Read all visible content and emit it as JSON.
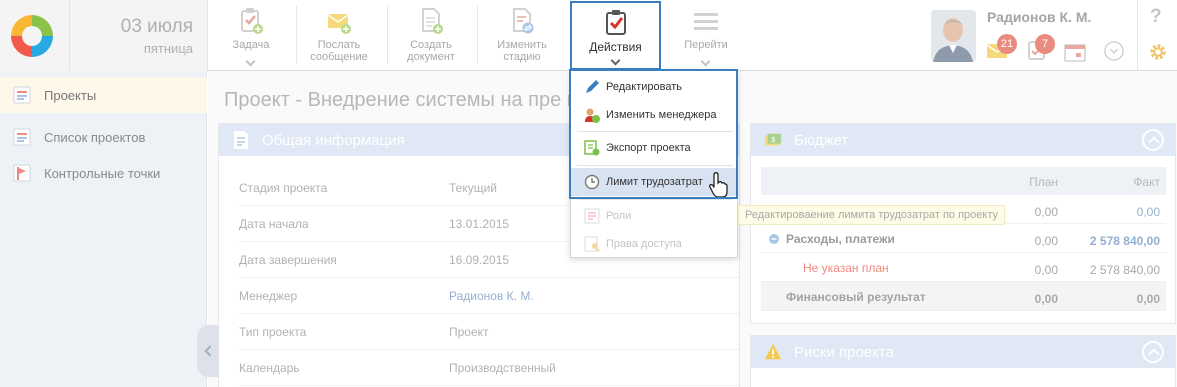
{
  "header": {
    "date_day": "03 июля",
    "date_weekday": "пятница",
    "toolbar": [
      {
        "label": "Задача",
        "icon": "task-clipboard-icon"
      },
      {
        "label": "Послать сообщение",
        "icon": "send-message-icon"
      },
      {
        "label": "Создать документ",
        "icon": "create-document-icon"
      },
      {
        "label": "Изменить стадию",
        "icon": "change-stage-icon"
      },
      {
        "label": "Действия",
        "icon": "actions-checklist-icon"
      },
      {
        "label": "Перейти",
        "icon": "navigate-menu-icon"
      }
    ],
    "user_name": "Радионов К. М.",
    "messages_count": "21",
    "tasks_count": "7",
    "help": "?"
  },
  "sidebar": {
    "items": [
      {
        "label": "Проекты",
        "icon": "projects-icon"
      },
      {
        "label": "Список проектов",
        "icon": "project-list-icon"
      },
      {
        "label": "Контрольные точки",
        "icon": "milestones-flag-icon"
      }
    ]
  },
  "main": {
    "page_title": "Проект - Внедрение системы на пре                  nWest\"",
    "general": {
      "title": "Общая информация",
      "rows": [
        {
          "label": "Стадия проекта",
          "value": "Текущий"
        },
        {
          "label": "Дата начала",
          "value": "13.01.2015"
        },
        {
          "label": "Дата завершения",
          "value": "16.09.2015"
        },
        {
          "label": "Менеджер",
          "value": "Радионов К. М."
        },
        {
          "label": "Тип проекта",
          "value": "Проект"
        },
        {
          "label": "Календарь",
          "value": "Производственный"
        }
      ]
    },
    "budget": {
      "title": "Бюджет",
      "col_plan": "План",
      "col_fact": "Факт",
      "rows": [
        {
          "name": "",
          "plan": "0,00",
          "fact": "0,00"
        },
        {
          "name": "Расходы, платежи",
          "plan": "0,00",
          "fact": "2 578 840,00"
        },
        {
          "name": "Не указан план",
          "plan": "0,00",
          "fact": "2 578 840,00"
        },
        {
          "name": "Финансовый результат",
          "plan": "0,00",
          "fact": "0,00"
        }
      ]
    },
    "risks": {
      "title": "Риски проекта"
    }
  },
  "actions_menu": {
    "items": [
      {
        "label": "Редактировать",
        "icon": "edit-pencil-icon",
        "enabled": true
      },
      {
        "label": "Изменить менеджера",
        "icon": "change-manager-icon",
        "enabled": true
      },
      {
        "label": "Экспорт проекта",
        "icon": "export-project-icon",
        "enabled": true
      },
      {
        "label": "Лимит трудозатрат",
        "icon": "clock-icon",
        "enabled": true
      },
      {
        "label": "Роли",
        "icon": "roles-icon",
        "enabled": false
      },
      {
        "label": "Права доступа",
        "icon": "access-rights-icon",
        "enabled": false
      }
    ],
    "tooltip": "Редактироваение лимита трудозатрат по проекту"
  },
  "colors": {
    "accent_blue": "#3a7ec2",
    "panel_header": "#dfe8f4",
    "badge": "#e98b7e",
    "negative_text": "#f08a80",
    "link_value": "#93b0d0"
  }
}
